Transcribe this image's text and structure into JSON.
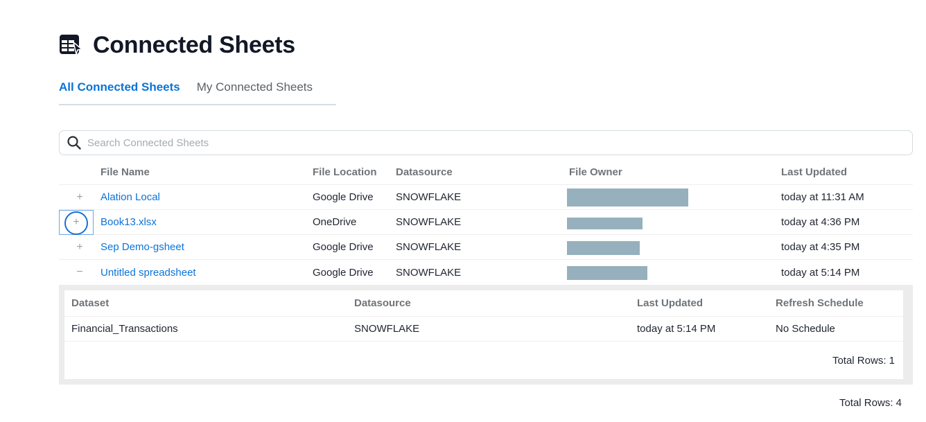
{
  "header": {
    "title": "Connected Sheets",
    "icon": "connected-sheets-icon"
  },
  "tabs": [
    {
      "label": "All Connected Sheets",
      "active": true
    },
    {
      "label": "My Connected Sheets",
      "active": false
    }
  ],
  "search": {
    "placeholder": "Search Connected Sheets",
    "value": "",
    "icon": "search-icon"
  },
  "table": {
    "columns": [
      "File Name",
      "File Location",
      "Datasource",
      "File Owner",
      "Last Updated"
    ],
    "rows": [
      {
        "toggle": "+",
        "file_name": "Alation Local",
        "file_location": "Google Drive",
        "datasource": "SNOWFLAKE",
        "file_owner": "[redacted]",
        "last_updated": "today at 11:31 AM",
        "expanded": false
      },
      {
        "toggle": "+",
        "file_name": "Book13.xlsx",
        "file_location": "OneDrive",
        "datasource": "SNOWFLAKE",
        "file_owner": "[redacted]",
        "last_updated": "today at 4:36 PM",
        "expanded": false,
        "focused": true
      },
      {
        "toggle": "+",
        "file_name": "Sep Demo-gsheet",
        "file_location": "Google Drive",
        "datasource": "SNOWFLAKE",
        "file_owner": "[redacted]",
        "last_updated": "today at 4:35 PM",
        "expanded": false
      },
      {
        "toggle": "−",
        "file_name": "Untitled spreadsheet",
        "file_location": "Google Drive",
        "datasource": "SNOWFLAKE",
        "file_owner": "[redacted]",
        "last_updated": "today at 5:14 PM",
        "expanded": true
      }
    ],
    "total_rows": "Total Rows: 4"
  },
  "nested": {
    "columns": [
      "Dataset",
      "Datasource",
      "Last Updated",
      "Refresh Schedule"
    ],
    "rows": [
      {
        "dataset": "Financial_Transactions",
        "datasource": "SNOWFLAKE",
        "last_updated": "today at 5:14 PM",
        "refresh_schedule": "No Schedule"
      }
    ],
    "total_rows": "Total Rows: 1"
  },
  "colors": {
    "accent": "#0a73d9",
    "redaction": "#96b0bd",
    "header_text": "#6e7479"
  }
}
